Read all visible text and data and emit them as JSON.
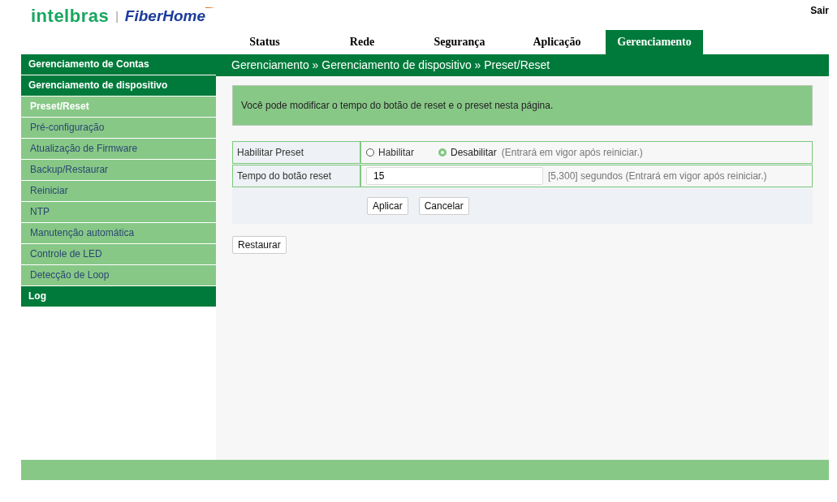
{
  "header": {
    "brand": "intelbras",
    "separator": "|",
    "partner": "FiberHome",
    "logout": "Sair"
  },
  "tabs": [
    {
      "label": "Status",
      "selected": false
    },
    {
      "label": "Rede",
      "selected": false
    },
    {
      "label": "Segurança",
      "selected": false
    },
    {
      "label": "Aplicação",
      "selected": false
    },
    {
      "label": "Gerenciamento",
      "selected": true
    }
  ],
  "sidebar": {
    "items": [
      {
        "label": "Gerenciamento de Contas"
      },
      {
        "label": "Gerenciamento de dispositivo",
        "children": [
          {
            "label": "Preset/Reset",
            "selected": true
          },
          {
            "label": "Pré-configuração",
            "selected": false
          },
          {
            "label": "Atualização de Firmware",
            "selected": false
          },
          {
            "label": "Backup/Restaurar",
            "selected": false
          },
          {
            "label": "Reiniciar",
            "selected": false
          },
          {
            "label": "NTP",
            "selected": false
          },
          {
            "label": "Manutenção automática",
            "selected": false
          },
          {
            "label": "Controle de LED",
            "selected": false
          },
          {
            "label": "Detecção de Loop",
            "selected": false
          }
        ]
      },
      {
        "label": "Log"
      }
    ]
  },
  "breadcrumb": "Gerenciamento » Gerenciamento de dispositivo » Preset/Reset",
  "info": "Você pode modificar o tempo do botão de reset e o preset nesta página.",
  "form": {
    "rows": [
      {
        "kind": "radio",
        "label": "Habilitar Preset",
        "options": [
          {
            "label": "Habilitar",
            "selected": false
          },
          {
            "label": "Desabilitar",
            "selected": true
          }
        ],
        "note": "(Entrará em vigor após reiniciar.)"
      },
      {
        "kind": "input",
        "label": "Tempo do botão reset",
        "value": "15",
        "note": "[5,300] segundos (Entrará em vigor após reiniciar.)"
      }
    ],
    "buttons": [
      "Aplicar",
      "Cancelar"
    ]
  },
  "restore_button": "Restaurar"
}
